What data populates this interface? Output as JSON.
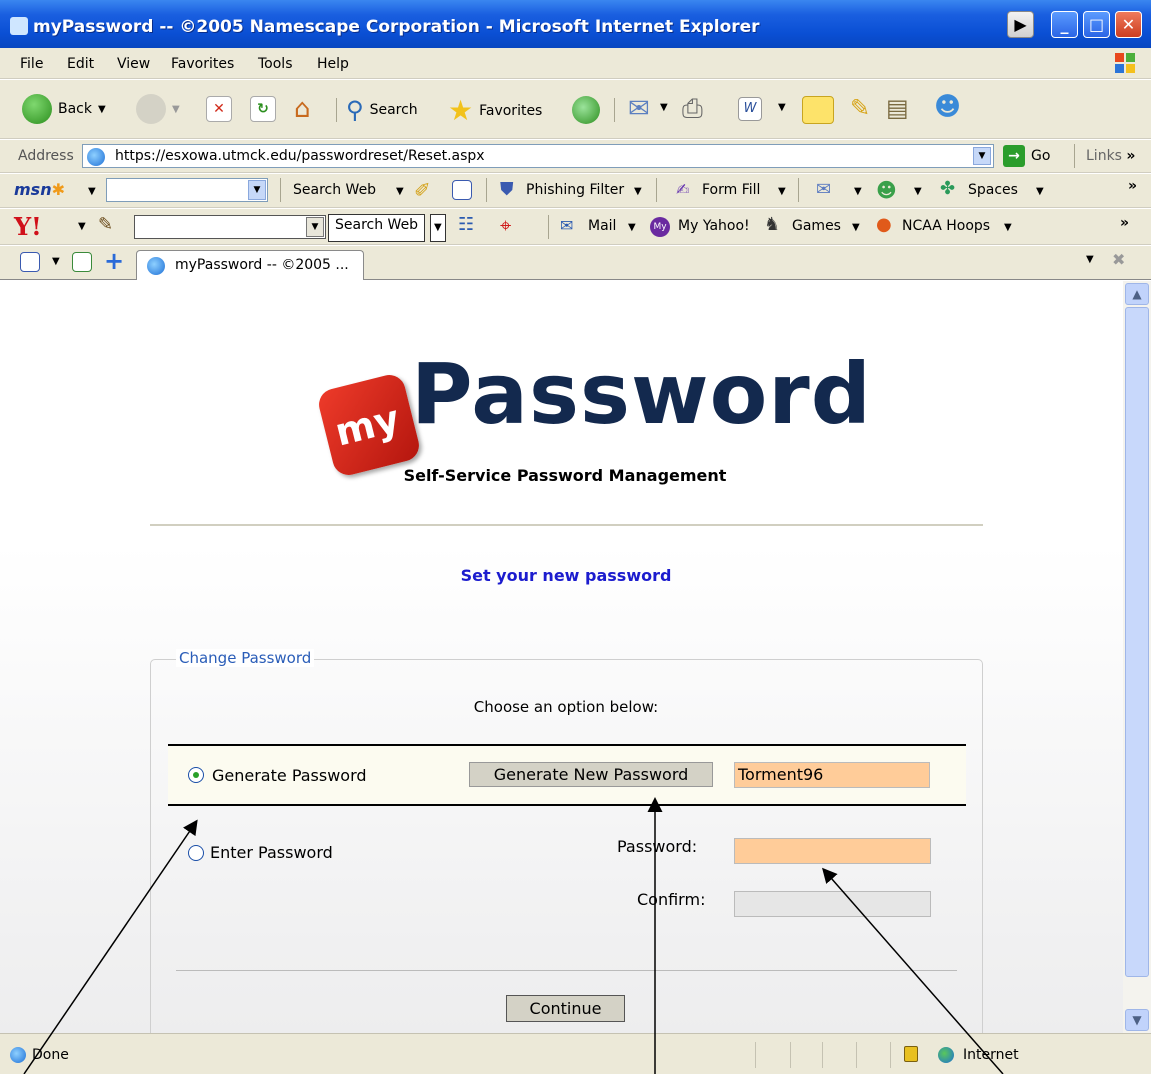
{
  "window": {
    "title": "myPassword -- ©2005 Namescape Corporation - Microsoft Internet Explorer"
  },
  "menu": [
    "File",
    "Edit",
    "View",
    "Favorites",
    "Tools",
    "Help"
  ],
  "toolbar": {
    "back": "Back",
    "search": "Search",
    "favorites": "Favorites"
  },
  "address": {
    "label": "Address",
    "url": "https://esxowa.utmck.edu/passwordreset/Reset.aspx",
    "go": "Go",
    "links": "Links"
  },
  "msn": {
    "search_web": "Search Web",
    "phishing": "Phishing Filter",
    "formfill": "Form Fill",
    "spaces": "Spaces"
  },
  "yahoo": {
    "search_web": "Search Web",
    "mail": "Mail",
    "my_yahoo": "My Yahoo!",
    "games": "Games",
    "ncaa": "NCAA Hoops"
  },
  "tab": {
    "title": "myPassword -- ©2005 ..."
  },
  "page": {
    "logo_badge": "my",
    "logo_word": "Password",
    "subtitle": "Self-Service Password Management",
    "heading": "Set your new password",
    "legend": "Change Password",
    "choose": "Choose an option below:",
    "option_generate": "Generate Password",
    "generate_button": "Generate New  Password",
    "generated_value": "Torment96",
    "option_enter": "Enter Password",
    "password_label": "Password:",
    "confirm_label": "Confirm:",
    "continue_button": "Continue"
  },
  "status": {
    "text": "Done",
    "zone": "Internet"
  },
  "colors": {
    "accent_blue": "#1c1cce",
    "field_peach": "#ffcc99",
    "logo_red": "#d52a1c",
    "logo_navy": "#13294e"
  }
}
